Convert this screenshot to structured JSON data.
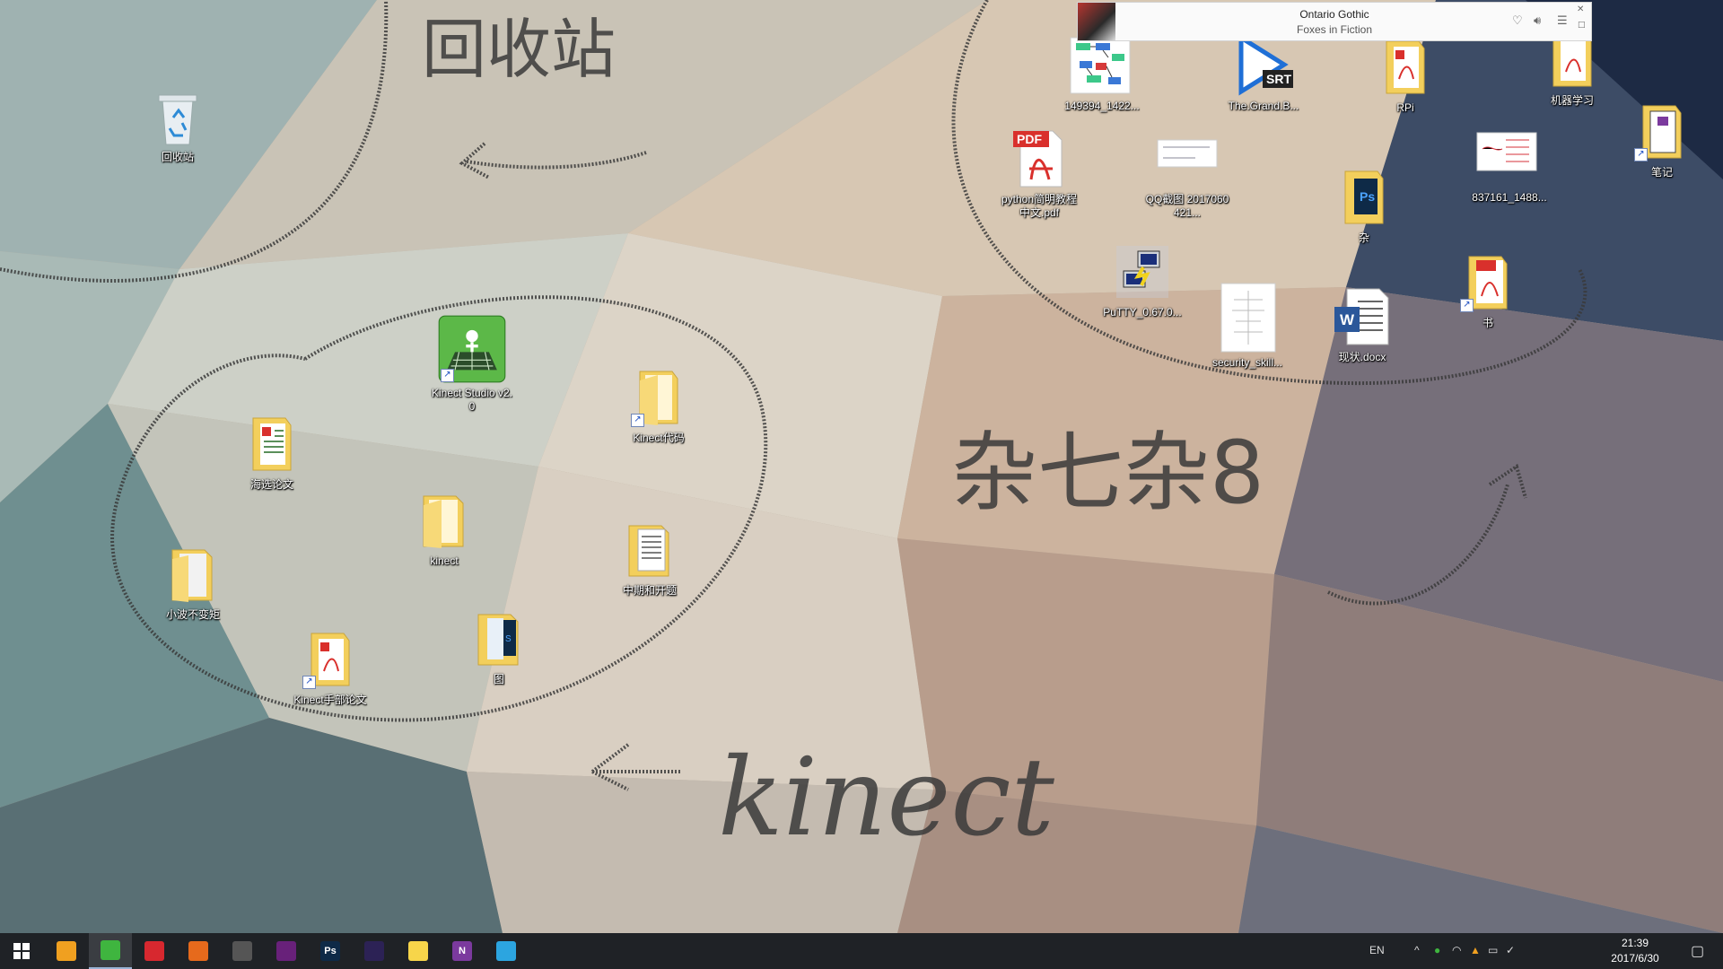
{
  "desktop": {
    "annotations": {
      "recycle_text": "回收站",
      "clutter_text": "杂七杂8",
      "kinect_text": "kinect"
    },
    "icons": {
      "recycle_bin": "回收站",
      "kinect_studio": "Kinect Studio v2.0",
      "kinect_code": "Kinect代码",
      "selected_papers": "海选论文",
      "kinect_folder": "kinect",
      "midterm": "中期和开题",
      "small_wave": "小波不变矩",
      "tu": "图",
      "kinect_hand_paper": "Kinect手部论文",
      "img_149394": "149394_1422...",
      "grand_b": "The.Grand.B...",
      "rpi": "RPi",
      "ml": "机器学习",
      "notes": "笔记",
      "python_pdf": "python简明教程中文.pdf",
      "qq_screenshot": "QQ截图 2017060421...",
      "za": "杂",
      "img_837161": "837161_1488...",
      "putty": "PuTTY_0.67.0...",
      "security": "security_skill...",
      "xianzhuang": "现状.docx",
      "shu": "书"
    },
    "badges": {
      "pdf": "PDF",
      "srt": "SRT",
      "ps": "Ps",
      "word": "W"
    }
  },
  "music_widget": {
    "title": "Ontario Gothic",
    "artist": "Foxes in Fiction"
  },
  "taskbar": {
    "apps": [
      {
        "name": "qq",
        "label": "",
        "color": "#f0a020"
      },
      {
        "name": "wechat",
        "label": "",
        "color": "#3fb53f"
      },
      {
        "name": "netease-music",
        "label": "",
        "color": "#d7282f"
      },
      {
        "name": "firefox",
        "label": "",
        "color": "#e66a1c"
      },
      {
        "name": "sublime",
        "label": "",
        "color": "#555"
      },
      {
        "name": "visual-studio",
        "label": "",
        "color": "#68217a"
      },
      {
        "name": "photoshop",
        "label": "Ps",
        "color": "#0e2a47"
      },
      {
        "name": "eclipse",
        "label": "",
        "color": "#2c2255"
      },
      {
        "name": "sticky-notes",
        "label": "",
        "color": "#f7d54a"
      },
      {
        "name": "onenote",
        "label": "N",
        "color": "#7b3a9e"
      },
      {
        "name": "telegram",
        "label": "",
        "color": "#2ca5e0"
      }
    ],
    "tray": {
      "lang": "EN"
    },
    "clock": {
      "time": "21:39",
      "date": "2017/6/30"
    }
  },
  "colors": {
    "taskbar_bg": "#1f2226",
    "folder_yellow": "#f3cf5c",
    "pdf_red": "#d9302c",
    "handwriting": "#3a3a3a"
  }
}
